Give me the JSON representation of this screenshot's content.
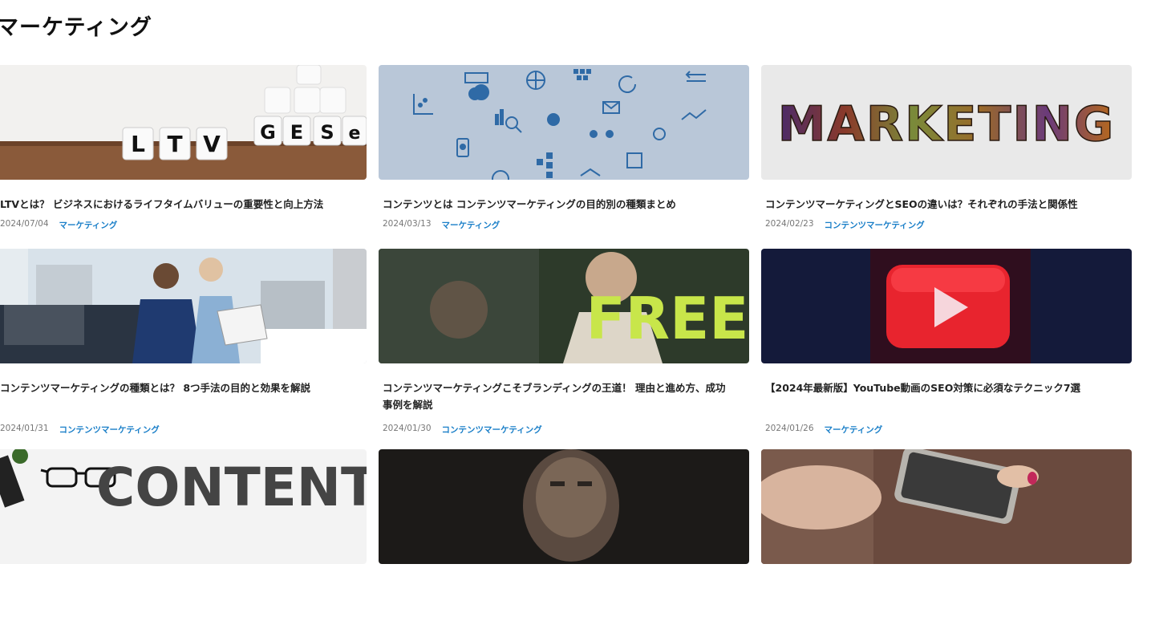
{
  "page": {
    "title": "マーケティング"
  },
  "articles": [
    {
      "title": "LTVとは？ ビジネスにおけるライフタイムバリューの重要性と向上方法",
      "date": "2024/07/04",
      "category": "マーケティング",
      "image_letters": [
        "L",
        "T",
        "V",
        "G",
        "E",
        "S",
        "e"
      ]
    },
    {
      "title": "コンテンツとは コンテンツマーケティングの目的別の種類まとめ",
      "date": "2024/03/13",
      "category": "マーケティング"
    },
    {
      "title": "コンテンツマーケティングとSEOの違いは？それぞれの手法と関係性",
      "date": "2024/02/23",
      "category": "コンテンツマーケティング",
      "image_text": "MARKETING"
    },
    {
      "title": "コンテンツマーケティングの種類とは？ 8つ手法の目的と効果を解説",
      "date": "2024/01/31",
      "category": "コンテンツマーケティング"
    },
    {
      "title": "コンテンツマーケティングこそブランディングの王道！ 理由と進め方、成功事例を解説",
      "date": "2024/01/30",
      "category": "コンテンツマーケティング",
      "image_text": "FREE"
    },
    {
      "title": "【2024年最新版】YouTube動画のSEO対策に必須なテクニック7選",
      "date": "2024/01/26",
      "category": "マーケティング"
    },
    {
      "image_text": "CONTENT"
    },
    {},
    {}
  ],
  "colors": {
    "accent": "#1a7fc8",
    "date": "#777777"
  }
}
